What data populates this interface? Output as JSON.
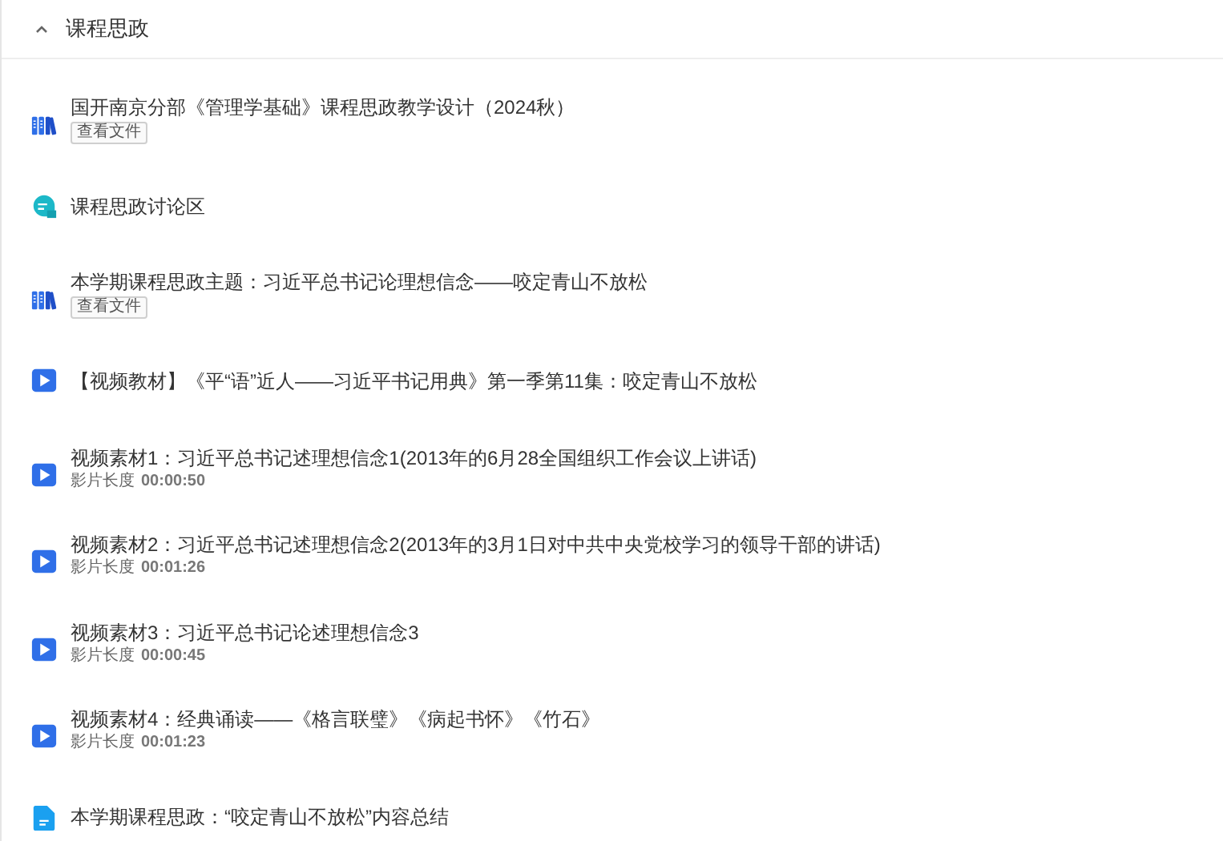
{
  "section": {
    "title": "课程思政",
    "expanded": true
  },
  "items": [
    {
      "kind": "book",
      "title": "国开南京分部《管理学基础》课程思政教学设计（2024秋）",
      "action": "查看文件"
    },
    {
      "kind": "discussion",
      "title": "课程思政讨论区"
    },
    {
      "kind": "book",
      "title": "本学期课程思政主题：习近平总书记论理想信念——咬定青山不放松",
      "action": "查看文件"
    },
    {
      "kind": "video",
      "title": "【视频教材】《平“语”近人——习近平书记用典》第一季第11集：咬定青山不放松"
    },
    {
      "kind": "video",
      "title": "视频素材1：习近平总书记述理想信念1(2013年的6月28全国组织工作会议上讲话)",
      "duration_label": "影片长度",
      "duration": "00:00:50"
    },
    {
      "kind": "video",
      "title": "视频素材2：习近平总书记述理想信念2(2013年的3月1日对中共中央党校学习的领导干部的讲话)",
      "duration_label": "影片长度",
      "duration": "00:01:26"
    },
    {
      "kind": "video",
      "title": "视频素材3：习近平总书记论述理想信念3",
      "duration_label": "影片长度",
      "duration": "00:00:45"
    },
    {
      "kind": "video",
      "title": "视频素材4：经典诵读——《格言联璧》《病起书怀》《竹石》",
      "duration_label": "影片长度",
      "duration": "00:01:23"
    },
    {
      "kind": "doc",
      "title": "本学期课程思政：“咬定青山不放松”内容总结"
    }
  ]
}
